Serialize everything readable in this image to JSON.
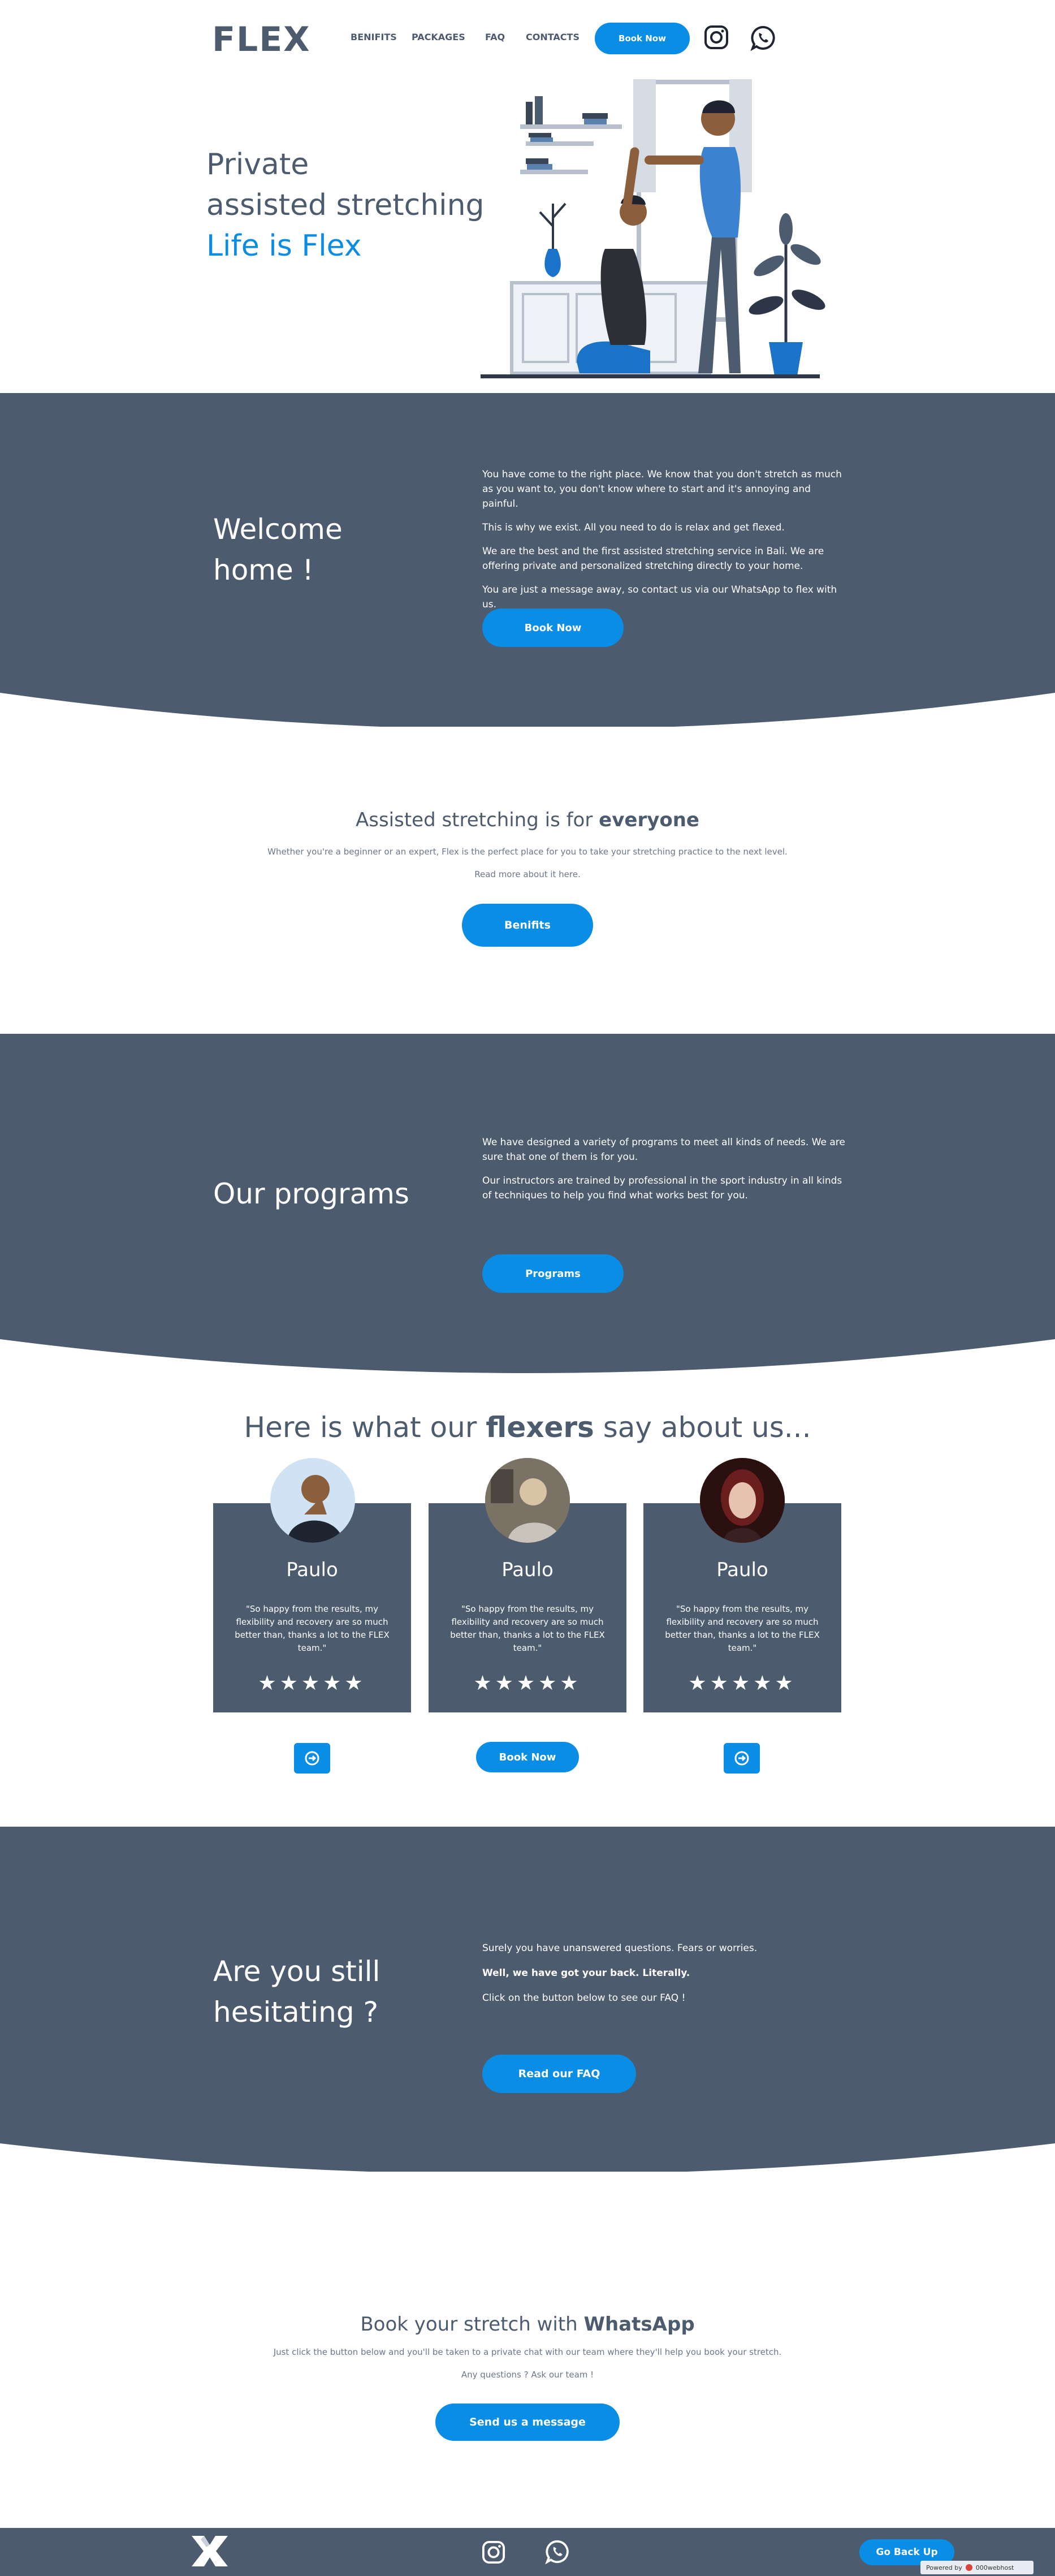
{
  "header": {
    "logo": "FLEX",
    "nav": [
      "BENIFITS",
      "PACKAGES",
      "FAQ",
      "CONTACTS"
    ],
    "book_button": "Book Now",
    "icons": [
      "instagram-icon",
      "whatsapp-icon"
    ]
  },
  "hero": {
    "line1": "Private",
    "line2": "assisted stretching",
    "line3": "Life is Flex"
  },
  "welcome": {
    "title_line1": "Welcome",
    "title_line2": "home !",
    "p1": "You have come to the right place. We know that you don't stretch as much as you want to, you don't know where to start and it's annoying and painful.",
    "p2": "This is why we exist. All you need to do is relax and get flexed.",
    "p3": "We are the best and the first assisted stretching service in Bali. We are offering private and personalized stretching directly to your home.",
    "p4": "You are just a message away, so contact us via our WhatsApp to flex with us.",
    "button": "Book Now"
  },
  "everyone": {
    "title_prefix": "Assisted stretching is for ",
    "title_bold": "everyone",
    "sub1": "Whether you're a beginner or an expert, Flex is the perfect place for you to take your stretching practice to the next level.",
    "sub2": "Read more about it here.",
    "button": "Benifits"
  },
  "programs": {
    "title": "Our programs",
    "p1": "We have designed a variety of programs to meet all kinds of needs. We are sure that one of them is for you.",
    "p2": "Our instructors are trained by professional in the sport industry in all kinds of techniques to help you find what works best for you.",
    "button": "Programs"
  },
  "testimonials": {
    "title_prefix": "Here is what our ",
    "title_bold": "flexers",
    "title_suffix": " say about us...",
    "cards": [
      {
        "name": "Paulo",
        "quote": "\"So happy from the results, my flexibility and recovery are so much better than, thanks a lot to the FLEX team.\"",
        "stars": "★★★★★",
        "rating": 5
      },
      {
        "name": "Paulo",
        "quote": "\"So happy from the results, my flexibility and recovery are so much better than, thanks a lot to the FLEX team.\"",
        "stars": "★★★★★",
        "rating": 5
      },
      {
        "name": "Paulo",
        "quote": "\"So happy from the results, my flexibility and recovery are so much better than, thanks a lot to the FLEX team.\"",
        "stars": "★★★★★",
        "rating": 5
      }
    ],
    "book_button": "Book Now"
  },
  "hesitating": {
    "title_line1": "Are you still",
    "title_line2": "hesitating ?",
    "p1": "Surely you have unanswered questions. Fears or worries.",
    "p2": "Well, we have got your back. Literally.",
    "p3": "Click on the button below to see our FAQ !",
    "button": "Read our FAQ"
  },
  "whatsapp": {
    "title_prefix": "Book your stretch with ",
    "title_bold": "WhatsApp",
    "sub1": "Just click the button below and you'll be taken to a private chat with our team where they'll help you book your stretch.",
    "sub2": "Any questions ? Ask our team !",
    "button": "Send us a message"
  },
  "footer": {
    "back_up": "Go Back Up",
    "powered": "Powered by",
    "host": "000webhost"
  },
  "colors": {
    "primary": "#0a8de4",
    "dark": "#4d5b6e"
  }
}
